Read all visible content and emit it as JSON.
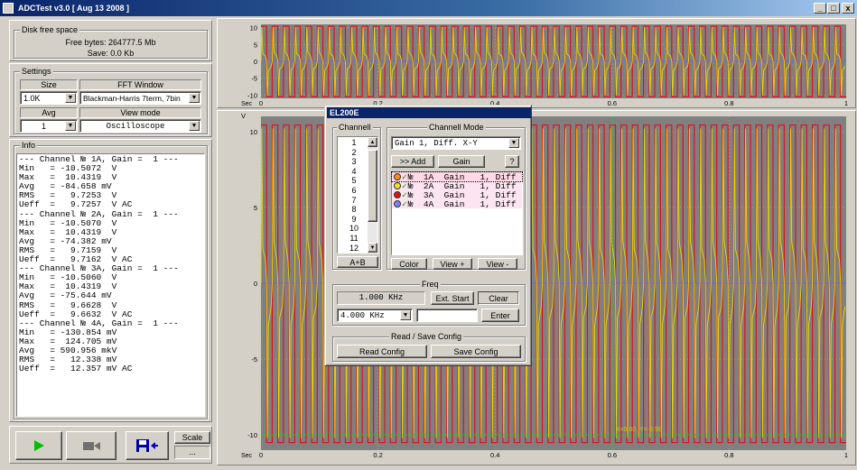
{
  "window": {
    "title": "ADCTest v3.0 [ Aug 13 2008 ]",
    "min": "_",
    "max": "□",
    "close": "x"
  },
  "disk": {
    "label": "Disk free space",
    "free": "Free bytes: 264777.5 Mb",
    "save": "Save:  0.0 Kb"
  },
  "settings": {
    "label": "Settings",
    "size_label": "Size",
    "size_value": "1.0K",
    "fft_label": "FFT Window",
    "fft_value": "Blackman-Harris 7term, 7bin",
    "avg_label": "Avg",
    "avg_value": "1",
    "view_label": "View mode",
    "view_value": "Oscilloscope"
  },
  "info": {
    "label": "Info",
    "lines": [
      "--- Channel № 1A, Gain =  1 ---",
      "Min   = -10.5072  V",
      "Max   =  10.4319  V",
      "Avg   = -84.658 mV",
      "RMS   =   9.7253  V",
      "Ueff  =   9.7257  V AC",
      "--- Channel № 2A, Gain =  1 ---",
      "Min   = -10.5070  V",
      "Max   =  10.4319  V",
      "Avg   = -74.382 mV",
      "RMS   =   9.7159  V",
      "Ueff  =   9.7162  V AC",
      "--- Channel № 3A, Gain =  1 ---",
      "Min   = -10.5060  V",
      "Max   =  10.4319  V",
      "Avg   = -75.644 mV",
      "RMS   =   9.6628  V",
      "Ueff  =   9.6632  V AC",
      "--- Channel № 4A, Gain =  1 ---",
      "Min   = -130.854 mV",
      "Max   =  124.705 mV",
      "Avg   = 590.956 mkV",
      "RMS   =   12.338 mV",
      "Ueff  =   12.357 mV AC"
    ]
  },
  "bottom": {
    "scale_label": "Scale",
    "scale_value": "..."
  },
  "top_plot": {
    "y_ticks": [
      "10",
      "5",
      "0",
      "-5",
      "-10"
    ],
    "x_unit": "Sec",
    "x_ticks": [
      "0",
      "0.2",
      "0.4",
      "0.6",
      "0.8",
      "1"
    ]
  },
  "main_plot": {
    "y_unit": "V",
    "y_ticks": [
      "10",
      "5",
      "0",
      "-5",
      "-10"
    ],
    "x_unit": "Sec",
    "x_ticks": [
      "0",
      "0.2",
      "0.4",
      "0.6",
      "0.8",
      "1"
    ],
    "cursor_readout": "X=0.60, Y=-9.98"
  },
  "dialog": {
    "title": "EL200E",
    "channel_label": "Channell",
    "channels": [
      "1",
      "2",
      "3",
      "4",
      "5",
      "6",
      "7",
      "8",
      "9",
      "10",
      "11",
      "12"
    ],
    "ab_button": "A+B",
    "mode_label": "Channell Mode",
    "mode_value": "Gain  1, Diff. X-Y",
    "add_button": ">> Add",
    "gain_button": "Gain",
    "help_button": "?",
    "active_channels": [
      {
        "text": "№  1A  Gain   1, Diff",
        "color": "#ff8c1a"
      },
      {
        "text": "№  2A  Gain   1, Diff",
        "color": "#f0e020"
      },
      {
        "text": "№  3A  Gain   1, Diff",
        "color": "#e01010"
      },
      {
        "text": "№  4A  Gain   1, Diff",
        "color": "#8080ff"
      }
    ],
    "color_button": "Color",
    "viewplus_button": "View +",
    "viewminus_button": "View -",
    "freq_label": "Freq",
    "freq_display": "1.000 KHz",
    "ext_start_button": "Ext. Start",
    "clear_button": "Clear",
    "freq_select": "4.000 KHz",
    "freq_input": "",
    "enter_button": "Enter",
    "rs_label": "Read / Save Config",
    "read_button": "Read Config",
    "save_button": "Save Config"
  },
  "colors": {
    "signal_red": "#e0101a",
    "signal_yellow": "#e8d800",
    "signal_orange": "#ff7f00",
    "grid_green": "#8fbc60",
    "zero_blue": "#6060ff"
  }
}
